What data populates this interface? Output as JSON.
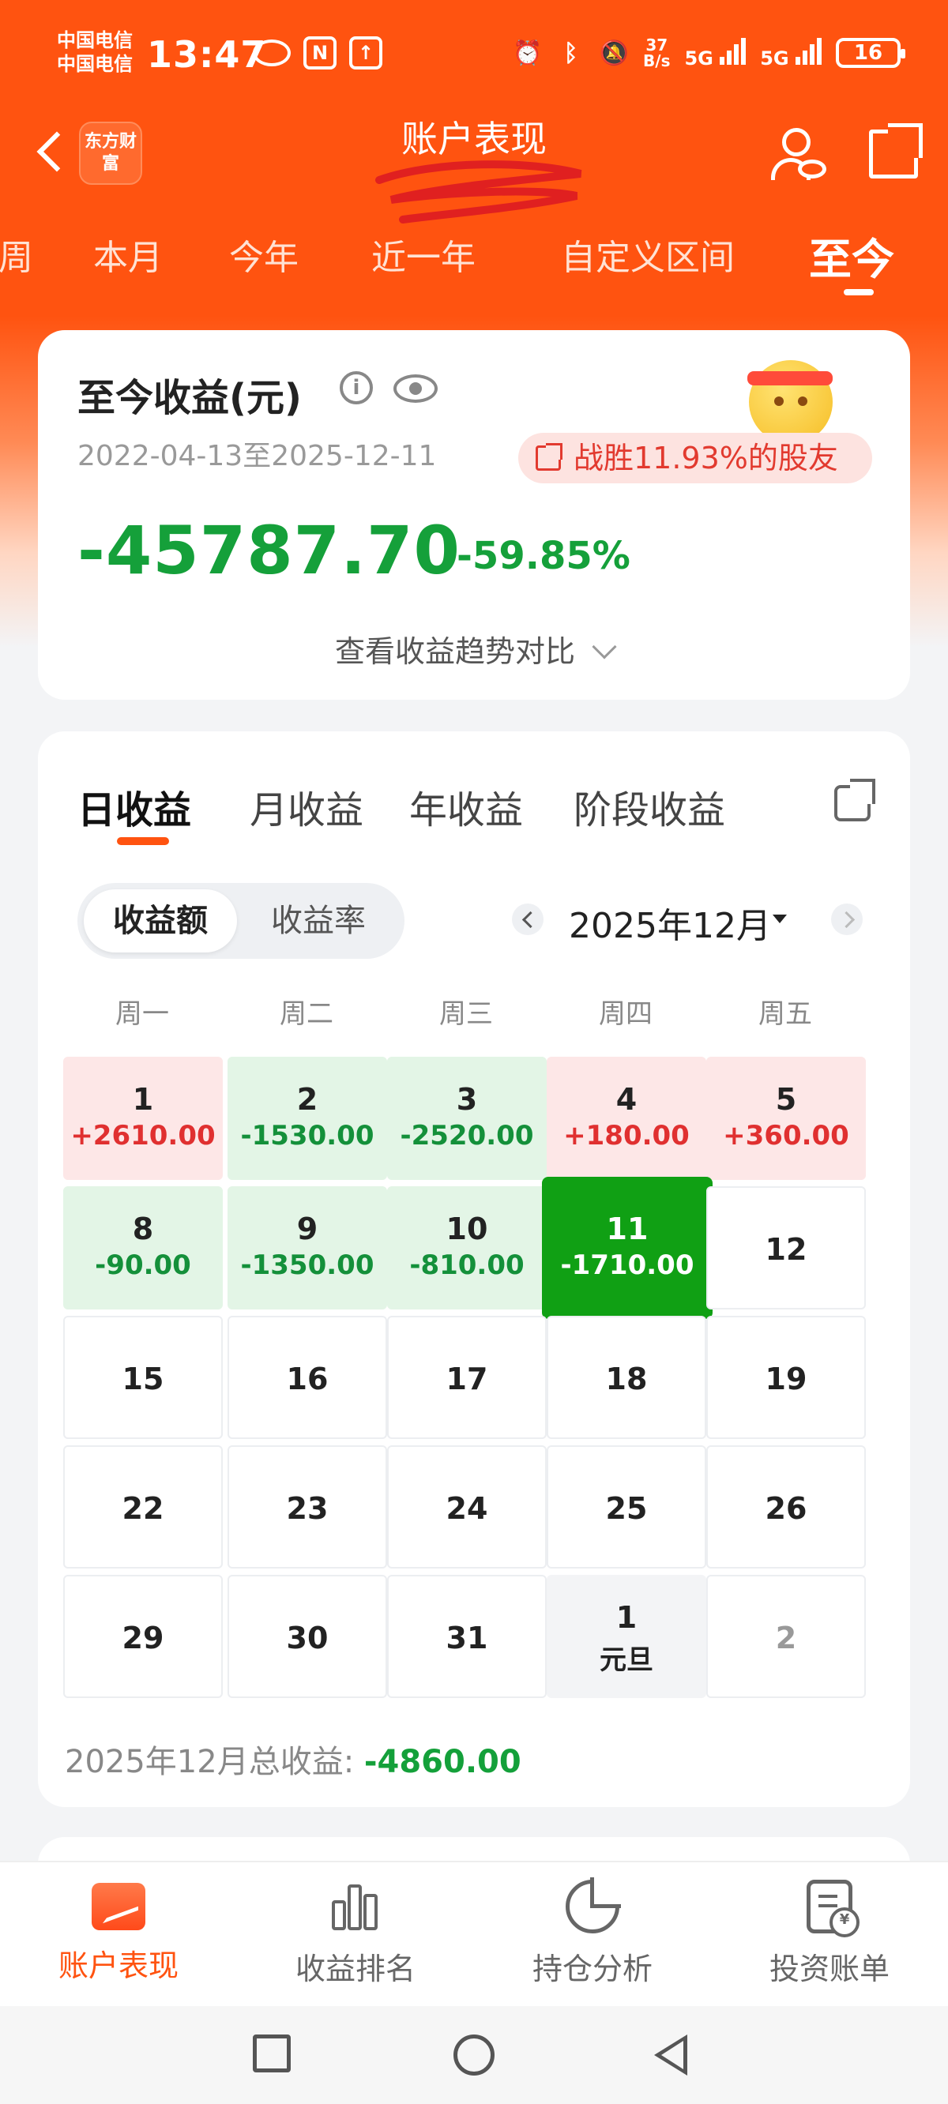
{
  "status_bar": {
    "carrier_1": "中国电信",
    "carrier_2": "中国电信",
    "time": "13:47",
    "net_speed_value": "37",
    "net_speed_unit": "B/s",
    "signal_1": "5G",
    "signal_2": "5G",
    "battery": "16"
  },
  "header": {
    "brand_logo_text": "东方财富",
    "title": "账户表现"
  },
  "period_tabs": [
    "周",
    "本月",
    "今年",
    "近一年",
    "自定义区间",
    "至今"
  ],
  "period_tabs_active": "至今",
  "summary": {
    "title": "至今收益(元)",
    "date_range": "2022-04-13至2025-12-11",
    "beat_text": "战胜11.93%的股友",
    "total_profit": "-45787.70",
    "total_rate": "-59.85%",
    "trend_link": "查看收益趋势对比"
  },
  "profit_tabs": [
    "日收益",
    "月收益",
    "年收益",
    "阶段收益"
  ],
  "profit_tabs_active": "日收益",
  "toggle": {
    "amount": "收益额",
    "rate": "收益率",
    "selected": "收益额"
  },
  "month_selector": {
    "label": "2025年12月"
  },
  "weekdays": [
    "周一",
    "周二",
    "周三",
    "周四",
    "周五"
  ],
  "calendar": [
    [
      {
        "day": "1",
        "value": "+2610.00",
        "type": "pos"
      },
      {
        "day": "2",
        "value": "-1530.00",
        "type": "neg"
      },
      {
        "day": "3",
        "value": "-2520.00",
        "type": "neg"
      },
      {
        "day": "4",
        "value": "+180.00",
        "type": "pos"
      },
      {
        "day": "5",
        "value": "+360.00",
        "type": "pos"
      }
    ],
    [
      {
        "day": "8",
        "value": "-90.00",
        "type": "neg"
      },
      {
        "day": "9",
        "value": "-1350.00",
        "type": "neg"
      },
      {
        "day": "10",
        "value": "-810.00",
        "type": "neg"
      },
      {
        "day": "11",
        "value": "-1710.00",
        "type": "today"
      },
      {
        "day": "12",
        "value": "",
        "type": "plain"
      }
    ],
    [
      {
        "day": "15",
        "value": "",
        "type": "plain"
      },
      {
        "day": "16",
        "value": "",
        "type": "plain"
      },
      {
        "day": "17",
        "value": "",
        "type": "plain"
      },
      {
        "day": "18",
        "value": "",
        "type": "plain"
      },
      {
        "day": "19",
        "value": "",
        "type": "plain"
      }
    ],
    [
      {
        "day": "22",
        "value": "",
        "type": "plain"
      },
      {
        "day": "23",
        "value": "",
        "type": "plain"
      },
      {
        "day": "24",
        "value": "",
        "type": "plain"
      },
      {
        "day": "25",
        "value": "",
        "type": "plain"
      },
      {
        "day": "26",
        "value": "",
        "type": "plain"
      }
    ],
    [
      {
        "day": "29",
        "value": "",
        "type": "plain"
      },
      {
        "day": "30",
        "value": "",
        "type": "plain"
      },
      {
        "day": "31",
        "value": "",
        "type": "plain"
      },
      {
        "day": "1",
        "value": "元旦",
        "type": "holiday"
      },
      {
        "day": "2",
        "value": "",
        "type": "next-month"
      }
    ]
  ],
  "month_total": {
    "label": "2025年12月总收益: ",
    "value": "-4860.00"
  },
  "bottom_nav": [
    {
      "label": "账户表现",
      "icon": "chart-screen-icon",
      "active": true
    },
    {
      "label": "收益排名",
      "icon": "bar-chart-icon",
      "active": false
    },
    {
      "label": "持仓分析",
      "icon": "pie-chart-icon",
      "active": false
    },
    {
      "label": "投资账单",
      "icon": "bill-icon",
      "active": false
    }
  ],
  "colors": {
    "brand_orange": "#ff5310",
    "profit_red": "#e03030",
    "loss_green": "#14903a",
    "today_green": "#10a014"
  }
}
